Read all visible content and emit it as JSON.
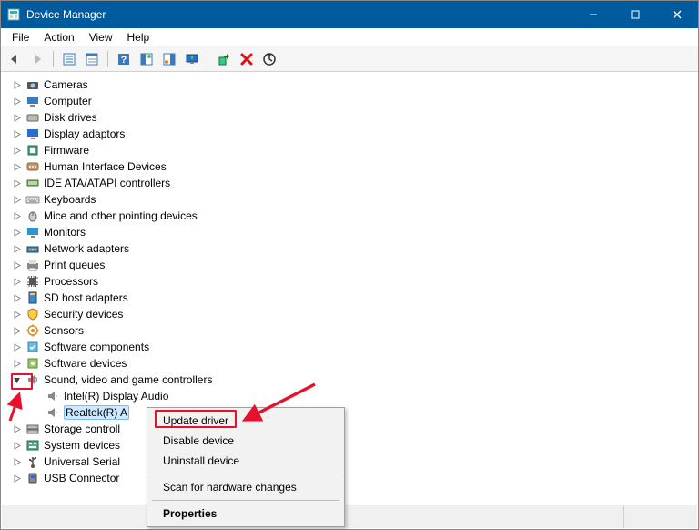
{
  "window": {
    "title": "Device Manager"
  },
  "menubar": {
    "items": [
      "File",
      "Action",
      "View",
      "Help"
    ]
  },
  "toolbar": {
    "buttons": [
      {
        "name": "back-icon",
        "glyph": "arrow-left"
      },
      {
        "name": "forward-icon",
        "glyph": "arrow-right"
      },
      {
        "sep": true
      },
      {
        "name": "show-hide-tree-icon",
        "glyph": "tree"
      },
      {
        "name": "properties-icon",
        "glyph": "props"
      },
      {
        "sep": true
      },
      {
        "name": "help-icon",
        "glyph": "help"
      },
      {
        "name": "action-a-icon",
        "glyph": "actiona"
      },
      {
        "name": "action-b-icon",
        "glyph": "actionb"
      },
      {
        "name": "monitor-update-icon",
        "glyph": "monup"
      },
      {
        "sep": true
      },
      {
        "name": "add-legacy-icon",
        "glyph": "addleg"
      },
      {
        "name": "uninstall-icon",
        "glyph": "uninst"
      },
      {
        "name": "scan-hardware-icon",
        "glyph": "scanhw"
      }
    ]
  },
  "tree": {
    "nodes": [
      {
        "label": "Cameras",
        "icon": "camera"
      },
      {
        "label": "Computer",
        "icon": "computer"
      },
      {
        "label": "Disk drives",
        "icon": "disk"
      },
      {
        "label": "Display adaptors",
        "icon": "display"
      },
      {
        "label": "Firmware",
        "icon": "firmware"
      },
      {
        "label": "Human Interface Devices",
        "icon": "hid"
      },
      {
        "label": "IDE ATA/ATAPI controllers",
        "icon": "ide"
      },
      {
        "label": "Keyboards",
        "icon": "keyboard"
      },
      {
        "label": "Mice and other pointing devices",
        "icon": "mouse"
      },
      {
        "label": "Monitors",
        "icon": "monitor"
      },
      {
        "label": "Network adapters",
        "icon": "network"
      },
      {
        "label": "Print queues",
        "icon": "print"
      },
      {
        "label": "Processors",
        "icon": "cpu"
      },
      {
        "label": "SD host adapters",
        "icon": "sd"
      },
      {
        "label": "Security devices",
        "icon": "security"
      },
      {
        "label": "Sensors",
        "icon": "sensor"
      },
      {
        "label": "Software components",
        "icon": "swcomp"
      },
      {
        "label": "Software devices",
        "icon": "swdev"
      },
      {
        "label": "Sound, video and game controllers",
        "icon": "sound",
        "expanded": true,
        "children": [
          {
            "label": "Intel(R) Display Audio",
            "icon": "speaker"
          },
          {
            "label": "Realtek(R) A",
            "icon": "speaker",
            "selected": true
          }
        ]
      },
      {
        "label": "Storage controll",
        "icon": "storage"
      },
      {
        "label": "System devices",
        "icon": "system"
      },
      {
        "label": "Universal Serial ",
        "icon": "usb"
      },
      {
        "label": "USB Connector",
        "icon": "usbconn"
      }
    ]
  },
  "context_menu": {
    "items": [
      {
        "label": "Update driver",
        "highlight": true
      },
      {
        "label": "Disable device"
      },
      {
        "label": "Uninstall device"
      },
      {
        "sep": true
      },
      {
        "label": "Scan for hardware changes"
      },
      {
        "sep": true
      },
      {
        "label": "Properties",
        "bold": true
      }
    ]
  }
}
